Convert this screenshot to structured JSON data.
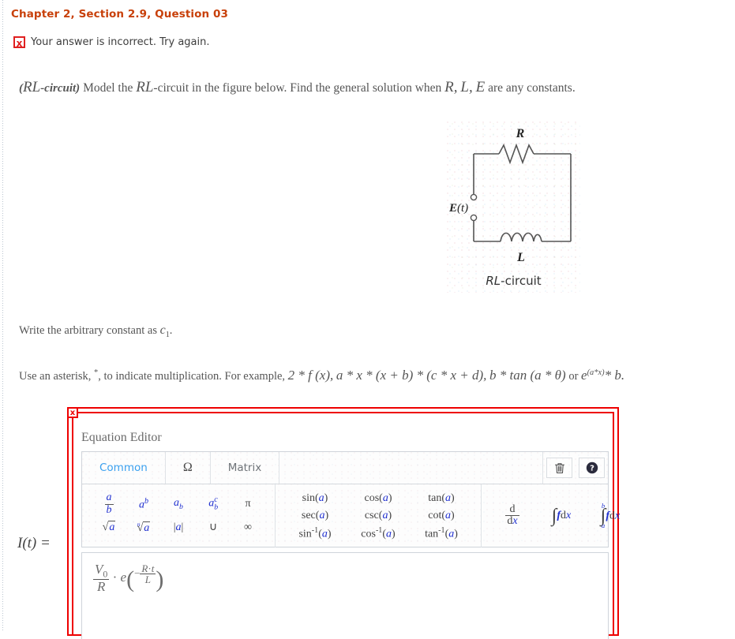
{
  "header": {
    "chapter_line": "Chapter 2, Section 2.9, Question 03",
    "feedback_icon": "x-mark-icon",
    "feedback_text": "Your answer is incorrect.  Try again."
  },
  "question": {
    "tag_open": "(",
    "tag_rl": "RL",
    "tag_circuit": "-circuit)",
    "text_1": "Model the",
    "text_rl2": "RL",
    "text_2": "-circuit in the figure below. Find the general solution when",
    "var_r": "R,",
    "var_l": "L,",
    "var_e": "E",
    "text_3": "are any constants."
  },
  "figure": {
    "resistor_label": "R",
    "source_label": "E(t)",
    "inductor_label": "L",
    "caption_italic": "RL",
    "caption_rest": "-circuit"
  },
  "notes": {
    "note1_pre": "Write the arbitrary constant as",
    "note1_var": "c",
    "note1_sub": "1",
    "note1_post": ".",
    "note2_pre": "Use an asterisk,",
    "note2_star": "*",
    "note2_mid": ", to indicate multiplication. For example,",
    "note2_ex1": "2 * f (x),",
    "note2_ex2": "a * x * (x + b) * (c * x + d),",
    "note2_ex3": "b * tan (a * θ)",
    "note2_or": "or",
    "note2_ex4_base": "e",
    "note2_ex4_sup": "(a*x)",
    "note2_ex4_tail": "* b."
  },
  "answer": {
    "label": "I(t) =",
    "expression_text": "V0/R · e^(−R·t/L)",
    "numerator": "V",
    "numerator_sub": "0",
    "denominator": "R",
    "multiply_dot": "·",
    "base_e": "e",
    "exp_minus": "−",
    "exp_num_r": "R",
    "exp_num_dot": "·",
    "exp_num_t": "t",
    "exp_den": "L"
  },
  "equation_editor": {
    "close_label": "x",
    "title": "Equation Editor",
    "tabs": [
      {
        "label": "Common",
        "active": true
      },
      {
        "label": "Ω",
        "active": false
      },
      {
        "label": "Matrix",
        "active": false
      }
    ],
    "tools": [
      {
        "name": "trash-icon",
        "glyph": "🗑"
      },
      {
        "name": "help-icon",
        "glyph": "?"
      }
    ],
    "palette_basic": [
      {
        "name": "fraction",
        "num": "a",
        "den": "b"
      },
      {
        "name": "superscript",
        "base": "a",
        "sup": "b"
      },
      {
        "name": "subscript",
        "base": "a",
        "sub": "b"
      },
      {
        "name": "sub-superscript",
        "base": "a",
        "sub": "b",
        "sup": "c"
      },
      {
        "name": "pi",
        "glyph": "π"
      },
      {
        "name": "square-root",
        "radicand": "a"
      },
      {
        "name": "nth-root",
        "index": "n",
        "radicand": "a"
      },
      {
        "name": "absolute-value",
        "arg": "a"
      },
      {
        "name": "union",
        "glyph": "∪"
      },
      {
        "name": "infinity",
        "glyph": "∞"
      }
    ],
    "palette_trig": [
      {
        "name": "sin",
        "fn": "sin",
        "arg": "a"
      },
      {
        "name": "cos",
        "fn": "cos",
        "arg": "a"
      },
      {
        "name": "tan",
        "fn": "tan",
        "arg": "a"
      },
      {
        "name": "sec",
        "fn": "sec",
        "arg": "a"
      },
      {
        "name": "csc",
        "fn": "csc",
        "arg": "a"
      },
      {
        "name": "cot",
        "fn": "cot",
        "arg": "a"
      },
      {
        "name": "arcsin",
        "fn": "sin",
        "sup": "-1",
        "arg": "a"
      },
      {
        "name": "arccos",
        "fn": "cos",
        "sup": "-1",
        "arg": "a"
      },
      {
        "name": "arctan",
        "fn": "tan",
        "sup": "-1",
        "arg": "a"
      }
    ],
    "palette_calculus": [
      {
        "name": "derivative",
        "num": "d",
        "den_d": "d",
        "den_x": "x"
      },
      {
        "name": "indefinite-integral",
        "sign": "∫",
        "f": "f",
        "d": "d",
        "x": "x"
      },
      {
        "name": "definite-integral",
        "sign": "∫",
        "upper": "b",
        "lower": "a",
        "f": "f",
        "d": "d",
        "x": "x"
      }
    ]
  },
  "colors": {
    "heading": "#c8400a",
    "error_red": "#e02020",
    "panel_red": "#ee0000",
    "tab_active": "#3aa0ef",
    "variable_blue": "#2030d0",
    "body_text": "#555555"
  }
}
